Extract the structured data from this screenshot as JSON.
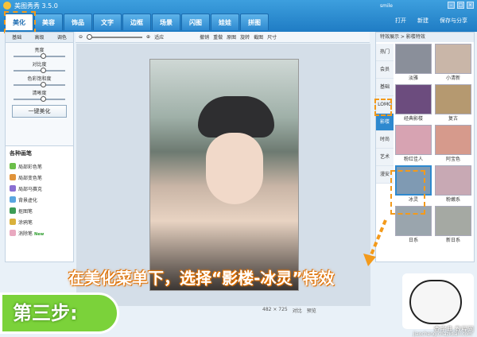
{
  "window": {
    "title": "美图秀秀 3.5.0",
    "user": "smile"
  },
  "tabs": [
    "美化",
    "美容",
    "饰品",
    "文字",
    "边框",
    "场景",
    "闪图",
    "娃娃",
    "拼图"
  ],
  "active_tab": "美化",
  "top_actions": {
    "open": "打开",
    "new": "新建",
    "save": "保存与分享"
  },
  "toolbar": {
    "fit": "适应",
    "undo": "撤销",
    "redo": "重做",
    "original": "原图",
    "rotate": "旋转",
    "crop": "截图",
    "size": "尺寸"
  },
  "sidebar": {
    "tabs": [
      "基础",
      "高级",
      "调色"
    ],
    "adjustments": [
      "亮度",
      "对比度",
      "色彩饱和度",
      "清晰度"
    ],
    "one_key": "一键美化",
    "brush_title": "各种画笔",
    "brushes": [
      "局部彩色笔",
      "局部变色笔",
      "局部马赛克",
      "背景虚化",
      "抠图笔",
      "涂鸦笔",
      "消除笔"
    ],
    "new_badge": "New"
  },
  "right_panel": {
    "header": "特效展示 > 影楼特效",
    "categories": [
      "热门",
      "会员",
      "基础",
      "LOMO",
      "影楼",
      "时尚",
      "艺术",
      "漫安"
    ],
    "thumbs": [
      "淡雅",
      "小清新",
      "经典影楼",
      "复古",
      "粉红佳人",
      "阿宝色",
      "冰灵",
      "粉嫩系",
      "日系",
      "新日系"
    ],
    "selected": "冰灵"
  },
  "status": {
    "dimensions": "482 × 725",
    "compare": "对比",
    "preview": "预览"
  },
  "callout": "在美化菜单下，选择“影楼-冰灵”特效",
  "step": "第三步:",
  "watermark": "查字典 教程网",
  "watermark_url": "jiaocheng.chazidian.com",
  "colors": {
    "accent": "#2e89cf",
    "highlight": "#f39a1b",
    "step_green": "#7bd23a"
  }
}
